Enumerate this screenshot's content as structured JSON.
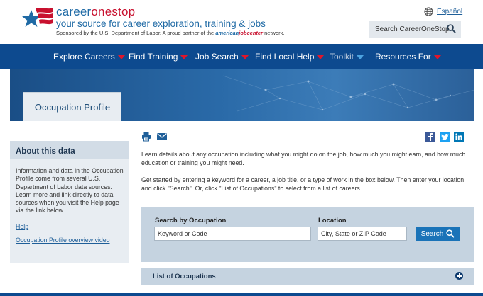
{
  "header": {
    "brand_part1": "career",
    "brand_part2": "onestop",
    "tagline": "your source for career exploration, training & jobs",
    "sponsor_text": "Sponsored by the U.S. Department of Labor. A proud partner of the",
    "partner_a": "american",
    "partner_b": "jobcenter",
    "sponsor_suffix": "network.",
    "language_link": "Español",
    "site_search_label": "Search CareerOneStop"
  },
  "nav": {
    "items": [
      {
        "label": "Explore Careers"
      },
      {
        "label": "Find Training"
      },
      {
        "label": "Job Search"
      },
      {
        "label": "Find Local Help"
      },
      {
        "label": "Toolkit"
      },
      {
        "label": "Resources For"
      }
    ]
  },
  "banner": {
    "tab_label": "Occupation Profile"
  },
  "sidebar": {
    "title": "About this data",
    "body": "Information and data in the Occupation Profile come from several U.S. Department of Labor data sources. Learn more and link directly to data sources when you visit the Help page via the link below.",
    "links": [
      {
        "label": "Help"
      },
      {
        "label": "Occupation Profile overview video"
      }
    ]
  },
  "main": {
    "intro1": "Learn details about any occupation including what you might do on the job, how much you might earn, and how much education or training you might need.",
    "intro2": "Get started by entering a keyword for a career, a job title, or a type of work in the box below. Then enter your location and click \"Search\". Or, click \"List of Occupations\" to select from a list of careers.",
    "search": {
      "occupation_label": "Search by Occupation",
      "occupation_placeholder": "Keyword or Code",
      "location_label": "Location",
      "location_placeholder": "City, State or ZIP Code",
      "button_label": "Search"
    },
    "list_label": "List of Occupations"
  },
  "icons": {
    "print": "printer-icon",
    "email": "email-icon",
    "facebook": "facebook-icon",
    "twitter": "twitter-icon",
    "linkedin": "linkedin-icon",
    "globe": "globe-icon",
    "search": "search-icon",
    "expand": "plus-circle-icon"
  },
  "colors": {
    "nav_bg": "#0d4a8f",
    "accent_red": "#e0162b",
    "search_button": "#1a73b8",
    "panel_bg": "#c5d3e0"
  }
}
